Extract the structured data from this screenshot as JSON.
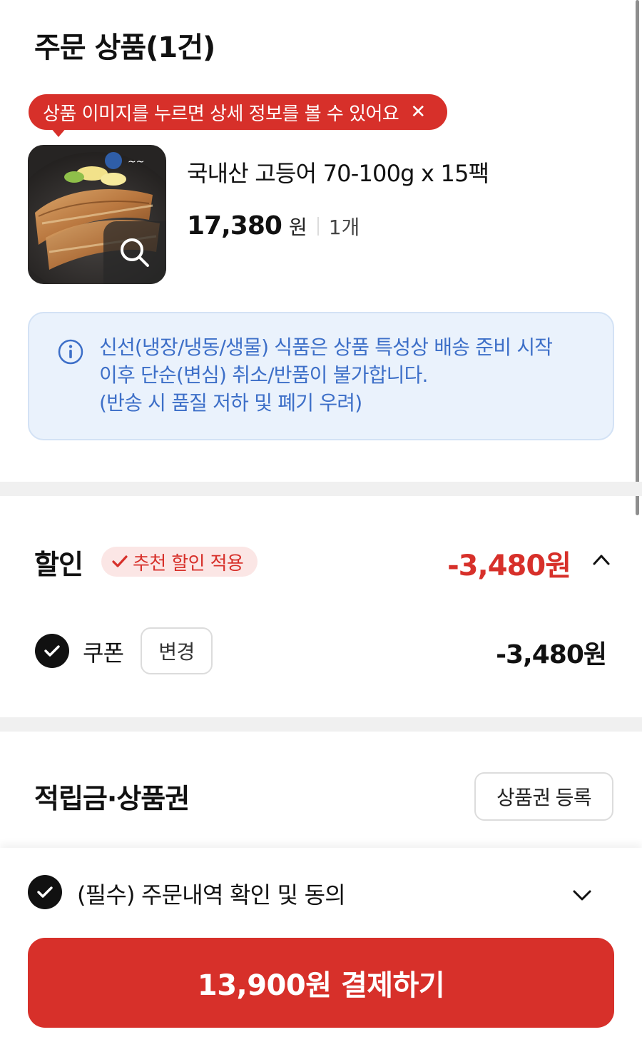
{
  "order": {
    "title": "주문 상품(1건)",
    "tooltip": {
      "text": "상품 이미지를 누르면 상세 정보를 볼 수 있어요",
      "close_icon": "close-icon"
    },
    "product": {
      "name": "국내산 고등어 70-100g x 15팩",
      "price": "17,380",
      "currency": "원",
      "quantity": "1개",
      "image_icon": "zoom-icon"
    },
    "notice": {
      "icon": "info-icon",
      "text": "신선(냉장/냉동/생물) 식품은 상품 특성상 배송 준비 시작\n이후 단순(변심) 취소/반품이 불가합니다.\n(반송 시 품질 저하 및 폐기 우려)"
    }
  },
  "discount": {
    "title": "할인",
    "badge": "추천 할인 적용",
    "total": "-3,480원",
    "coupon": {
      "label": "쿠폰",
      "change_label": "변경",
      "amount": "-3,480원"
    }
  },
  "points": {
    "title": "적립금·상품권",
    "register_label": "상품권 등록"
  },
  "checkout": {
    "agreement_label": "(필수) 주문내역 확인 및 동의",
    "pay_label": "13,900원 결제하기"
  },
  "colors": {
    "accent": "#d7302a",
    "notice_bg": "#eaf2fc",
    "notice_text": "#3d6fc8"
  }
}
